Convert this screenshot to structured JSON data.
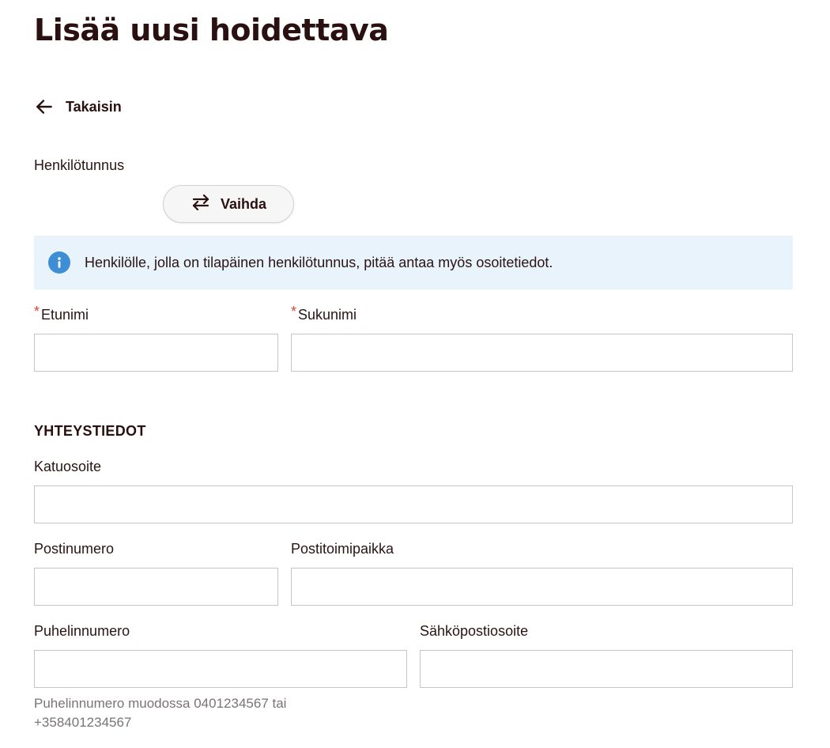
{
  "page": {
    "title": "Lisää uusi hoidettava"
  },
  "back": {
    "label": "Takaisin",
    "icon": "arrow-left-icon"
  },
  "ssn": {
    "label": "Henkilötunnus",
    "switch_label": "Vaihda",
    "switch_icon": "swap-arrows-icon"
  },
  "info": {
    "icon": "info-icon",
    "text": "Henkilölle, jolla on tilapäinen henkilötunnus, pitää antaa myös osoitetiedot.",
    "background": "#e8f3fb",
    "icon_color": "#3d8ed4"
  },
  "name": {
    "required_mark": "*",
    "first_name_label": "Etunimi",
    "first_name_value": "",
    "last_name_label": "Sukunimi",
    "last_name_value": ""
  },
  "contact": {
    "section_title": "YHTEYSTIEDOT",
    "street_label": "Katuosoite",
    "street_value": "",
    "postal_code_label": "Postinumero",
    "postal_code_value": "",
    "city_label": "Postitoimipaikka",
    "city_value": "",
    "phone_label": "Puhelinnumero",
    "phone_value": "",
    "phone_hint": "Puhelinnumero muodossa 0401234567 tai +358401234567",
    "email_label": "Sähköpostiosoite",
    "email_value": ""
  },
  "colors": {
    "text": "#2a1414",
    "required": "#d9433b",
    "border": "#c9c4c4",
    "hint": "#7a7474"
  }
}
